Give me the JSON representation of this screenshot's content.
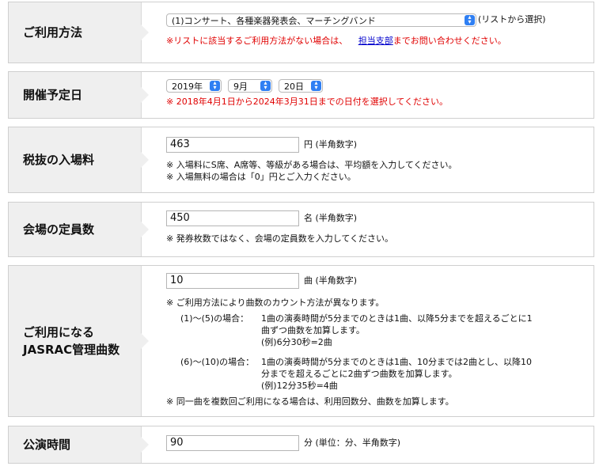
{
  "usage": {
    "label": "ご利用方法",
    "select_value": "(1)コンサート、各種楽器発表会、マーチングバンド",
    "select_hint": "(リストから選択)",
    "note_pre": "※リストに該当するご利用方法がない場合は、",
    "note_link": "担当支部",
    "note_post": "までお問い合わせください。"
  },
  "date": {
    "label": "開催予定日",
    "year": "2019年",
    "month": "9月",
    "day": "20日",
    "note": "※ 2018年4月1日から2024年3月31日までの日付を選択してください。"
  },
  "fee": {
    "label": "税抜の入場料",
    "value": "463",
    "unit": "円 (半角数字)",
    "note1": "※ 入場料にS席、A席等、等級がある場合は、平均額を入力してください。",
    "note2": "※ 入場無料の場合は「0」円とご入力ください。"
  },
  "capacity": {
    "label": "会場の定員数",
    "value": "450",
    "unit": "名 (半角数字)",
    "note": "※ 発券枚数ではなく、会場の定員数を入力してください。"
  },
  "songs": {
    "label_line1": "ご利用になる",
    "label_line2": "JASRAC管理曲数",
    "value": "10",
    "unit": "曲 (半角数字)",
    "note_intro": "※ ご利用方法により曲数のカウント方法が異なります。",
    "case1_title": "(1)～(5)の場合：",
    "case1_line1": "1曲の演奏時間が5分までのときは1曲、以降5分までを超えるごとに1",
    "case1_line2": "曲ずつ曲数を加算します。",
    "case1_line3": "(例)6分30秒=2曲",
    "case2_title": "(6)～(10)の場合：",
    "case2_line1": "1曲の演奏時間が5分までのときは1曲、10分までは2曲とし、以降10",
    "case2_line2": "分までを超えるごとに2曲ずつ曲数を加算します。",
    "case2_line3": "(例)12分35秒=4曲",
    "note_end": "※ 同一曲を複数回ご利用になる場合は、利用回数分、曲数を加算します。"
  },
  "duration": {
    "label": "公演時間",
    "value": "90",
    "unit": "分 (単位：分、半角数字)"
  }
}
